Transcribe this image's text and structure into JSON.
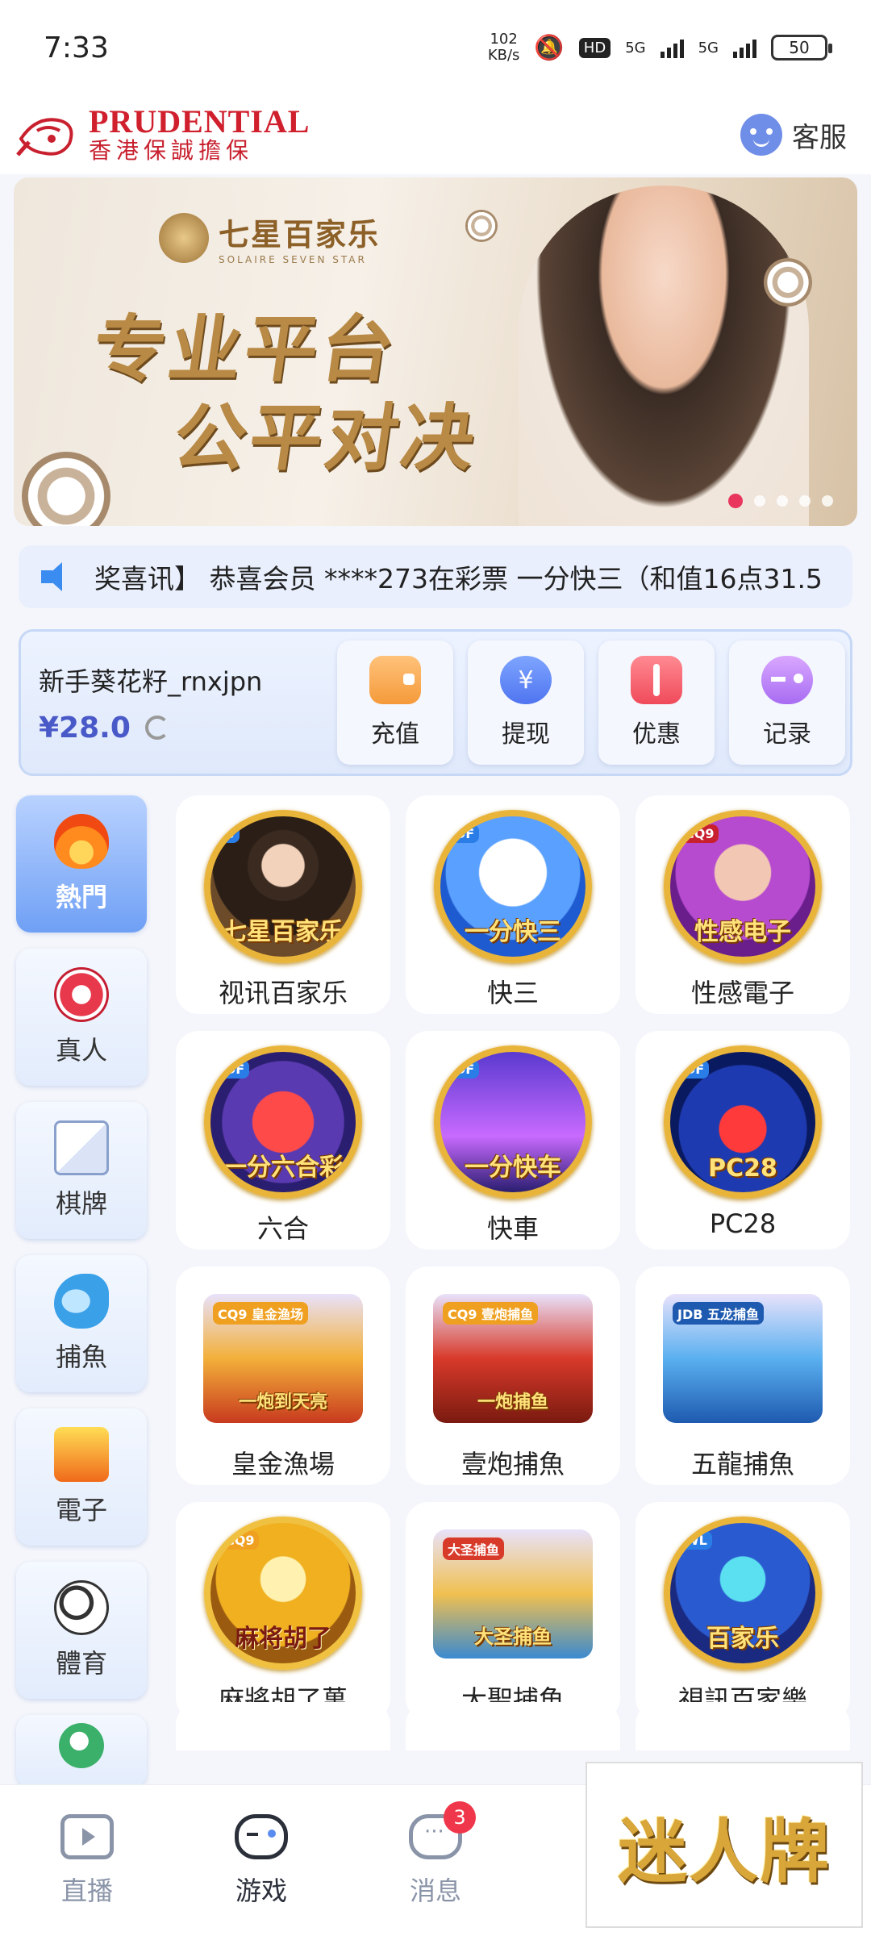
{
  "status_bar": {
    "time": "7:33",
    "net_speed_value": "102",
    "net_speed_unit": "KB/s",
    "hd_label": "HD",
    "signal1_label": "5G",
    "signal2_label": "5G",
    "battery": "50"
  },
  "header": {
    "logo_en": "PRUDENTIAL",
    "logo_cn": "香港保誠擔保",
    "service_label": "客服"
  },
  "banner": {
    "brand": "七星百家乐",
    "brand_sub": "SOLAIRE SEVEN STAR",
    "line1": "专业平台",
    "line2": "公平对决",
    "slide_count": 5,
    "active_slide": 1
  },
  "marquee": {
    "text": "奖喜讯】 恭喜会员 ****273在彩票 一分快三（和值16点31.5"
  },
  "wallet": {
    "username": "新手葵花籽_rnxjpn",
    "balance": "¥28.0",
    "actions": [
      {
        "label": "充值",
        "icon": "wallet-icon"
      },
      {
        "label": "提现",
        "icon": "yen-coin-icon"
      },
      {
        "label": "优惠",
        "icon": "ticket-icon"
      },
      {
        "label": "记录",
        "icon": "gamepad-icon"
      }
    ]
  },
  "categories": [
    {
      "label": "熱門",
      "icon": "fire-icon",
      "active": true
    },
    {
      "label": "真人",
      "icon": "casino-chip-icon",
      "active": false
    },
    {
      "label": "棋牌",
      "icon": "playing-cards-icon",
      "active": false
    },
    {
      "label": "捕魚",
      "icon": "shark-icon",
      "active": false
    },
    {
      "label": "電子",
      "icon": "slot-777-icon",
      "active": false
    },
    {
      "label": "體育",
      "icon": "soccer-ball-icon",
      "active": false
    },
    {
      "label": "",
      "icon": "lottery-ball-icon",
      "active": false
    }
  ],
  "games": [
    {
      "label": "视讯百家乐",
      "caption": "七星百家乐",
      "provider": "S"
    },
    {
      "label": "快三",
      "caption": "一分快三",
      "provider": "DF"
    },
    {
      "label": "性感電子",
      "caption": "性感电子",
      "provider": "CQ9"
    },
    {
      "label": "六合",
      "caption": "一分六合彩",
      "provider": "DF"
    },
    {
      "label": "快車",
      "caption": "一分快车",
      "provider": "DF"
    },
    {
      "label": "PC28",
      "caption": "PC28",
      "provider": "DF"
    },
    {
      "label": "皇金漁場",
      "caption": "一炮到天亮",
      "provider": "CQ9 皇金渔场"
    },
    {
      "label": "壹炮捕魚",
      "caption": "一炮捕鱼",
      "provider": "CQ9 壹炮捕鱼"
    },
    {
      "label": "五龍捕魚",
      "caption": "",
      "provider": "JDB 五龙捕鱼"
    },
    {
      "label": "麻將胡了萬",
      "caption": "麻将胡了",
      "provider": "CQ9"
    },
    {
      "label": "大聖捕魚",
      "caption": "大圣捕鱼",
      "provider": "大圣捕鱼"
    },
    {
      "label": "視訊百家樂",
      "caption": "百家乐",
      "provider": "WL"
    }
  ],
  "bottom_nav": [
    {
      "label": "直播",
      "icon": "tv-play-icon",
      "active": false
    },
    {
      "label": "游戏",
      "icon": "gamepad-icon",
      "active": true
    },
    {
      "label": "消息",
      "icon": "chat-bubble-icon",
      "active": false,
      "badge": "3"
    }
  ],
  "ad_overlay": {
    "text": "迷人牌"
  }
}
